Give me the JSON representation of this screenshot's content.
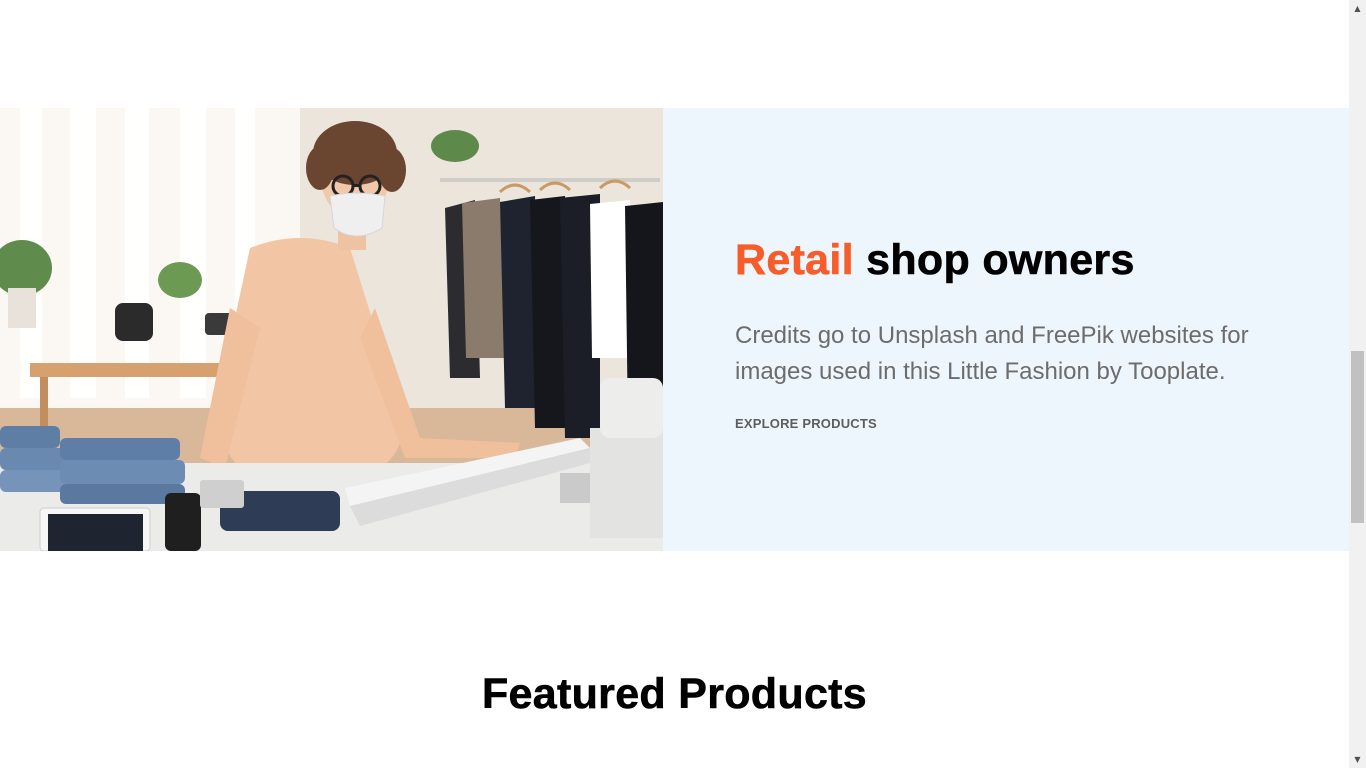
{
  "hero": {
    "title_accent": "Retail",
    "title_rest": " shop owners",
    "description": "Credits go to Unsplash and FreePik websites for images used in this Little Fashion by Tooplate.",
    "link_label": "EXPLORE PRODUCTS",
    "image_alt": "Shop owner wearing a face mask at a retail counter"
  },
  "featured": {
    "title": "Featured Products"
  },
  "colors": {
    "accent": "#f65d2a",
    "panel_background": "#eef6fd",
    "text_muted": "#6c6c6c"
  },
  "icons": {
    "scroll_up": "triangle-up-icon",
    "scroll_down": "triangle-down-icon"
  }
}
